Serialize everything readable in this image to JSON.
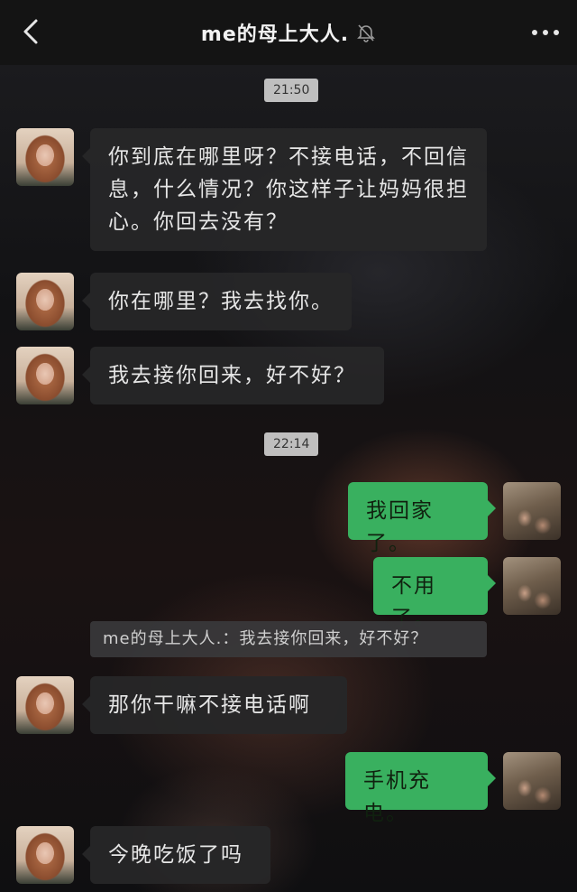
{
  "header": {
    "title": "me的母上大人.",
    "back_icon": "chevron-left-icon",
    "mute_icon": "bell-off-icon",
    "more_icon": "more-dots-icon"
  },
  "timestamps": [
    "21:50",
    "22:14"
  ],
  "messages": [
    {
      "from": "mom",
      "text": "你到底在哪里呀？不接电话，不回信息，什么情况？你这样子让妈妈很担心。你回去没有？"
    },
    {
      "from": "mom",
      "text": "你在哪里？我去找你。"
    },
    {
      "from": "mom",
      "text": "我去接你回来，好不好？"
    },
    {
      "from": "me",
      "text": "我回家了。"
    },
    {
      "from": "me",
      "text": "不用了。"
    },
    {
      "from": "mom",
      "text": "那你干嘛不接电话啊"
    },
    {
      "from": "me",
      "text": "手机充电。"
    },
    {
      "from": "mom",
      "text": "今晚吃饭了吗"
    }
  ],
  "quote": {
    "text": "me的母上大人.：我去接你回来，好不好？"
  },
  "colors": {
    "sent_bubble": "#39b05f",
    "received_bubble": "#262628",
    "header_bg": "#141414"
  }
}
